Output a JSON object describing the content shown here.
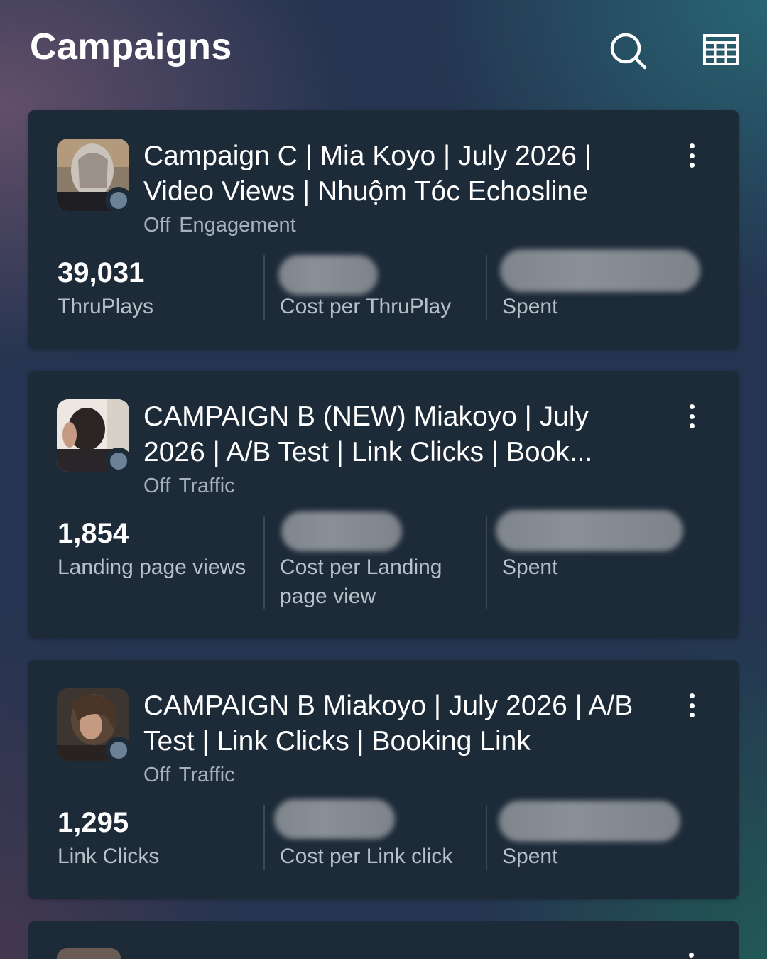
{
  "header": {
    "title": "Campaigns",
    "search_icon": "search-icon",
    "table_icon": "table-view-icon"
  },
  "campaigns": [
    {
      "name": "Campaign C | Mia Koyo | July 2026 | Video Views | Nhuộm Tóc Echosline",
      "status": "Off",
      "objective": "Engagement",
      "metric_value": "39,031",
      "metric_label": "ThruPlays",
      "cost_label": "Cost per ThruPlay",
      "spent_label": "Spent"
    },
    {
      "name": "CAMPAIGN B (NEW) Miakoyo | July 2026 | A/B Test | Link Clicks | Book...",
      "status": "Off",
      "objective": "Traffic",
      "metric_value": "1,854",
      "metric_label": "Landing page views",
      "cost_label": "Cost per Landing page view",
      "spent_label": "Spent"
    },
    {
      "name": "CAMPAIGN B Miakoyo | July 2026 | A/B Test | Link Clicks | Booking Link",
      "status": "Off",
      "objective": "Traffic",
      "metric_value": "1,295",
      "metric_label": "Link Clicks",
      "cost_label": "Cost per Link click",
      "spent_label": "Spent"
    }
  ],
  "colors": {
    "card_bg": "#1d2a38",
    "status_dot": "#6b8195",
    "muted_text": "#a5b1bc"
  }
}
